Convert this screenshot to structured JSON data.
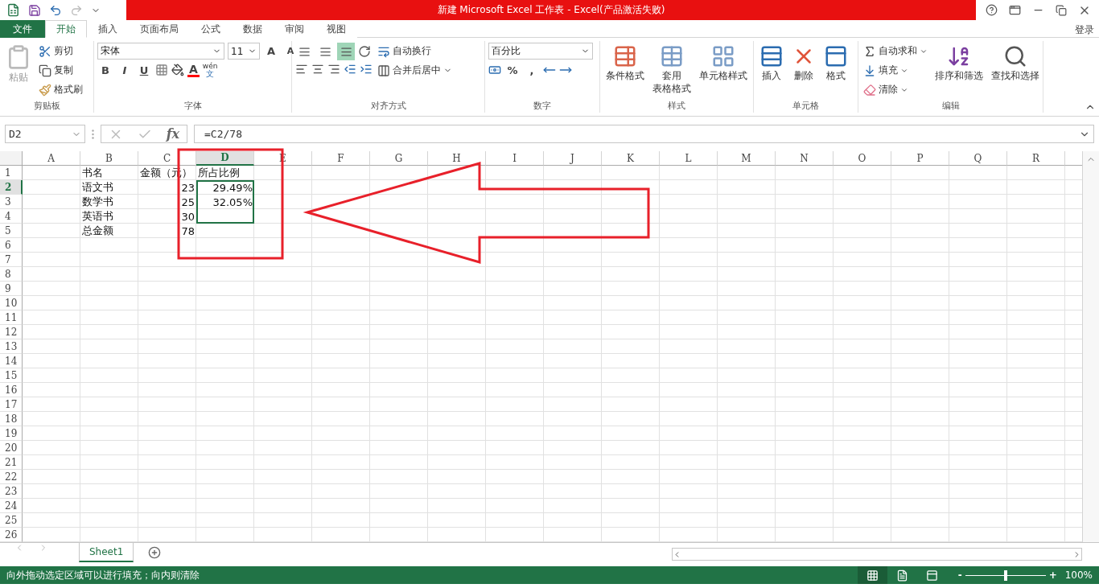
{
  "window": {
    "title": "新建 Microsoft Excel 工作表 -  Excel(产品激活失败)"
  },
  "ribbon_tabs": [
    {
      "label": "文件",
      "kind": "file",
      "selected": false
    },
    {
      "label": "开始",
      "kind": "tab",
      "selected": true
    },
    {
      "label": "插入",
      "kind": "tab",
      "selected": false
    },
    {
      "label": "页面布局",
      "kind": "tab",
      "selected": false
    },
    {
      "label": "公式",
      "kind": "tab",
      "selected": false
    },
    {
      "label": "数据",
      "kind": "tab",
      "selected": false
    },
    {
      "label": "审阅",
      "kind": "tab",
      "selected": false
    },
    {
      "label": "视图",
      "kind": "tab",
      "selected": false
    }
  ],
  "account": "登录",
  "ribbon": {
    "clipboard": {
      "label": "剪贴板",
      "paste": {
        "label": "粘贴",
        "disabled": true
      },
      "small": [
        "剪切",
        "复制",
        "格式刷"
      ]
    },
    "font": {
      "label": "字体",
      "font_name": "宋体",
      "font_size": "11",
      "grow": "A",
      "shrink": "A",
      "styles": [
        "B",
        "I",
        "U"
      ],
      "font_color": "A",
      "phonetic_top": "wén",
      "phonetic_bottom": "文"
    },
    "alignment": {
      "label": "对齐方式",
      "vertical": [
        {
          "selected": false
        },
        {
          "selected": false
        },
        {
          "selected": true
        }
      ],
      "wrap": "自动换行",
      "merge": "合并后居中"
    },
    "number": {
      "label": "数字",
      "format": "百分比",
      "percent": "%",
      "comma": ","
    },
    "styles": {
      "label": "样式",
      "buttons": [
        {
          "lines": [
            "条件格式"
          ]
        },
        {
          "lines": [
            "套用",
            "表格格式"
          ]
        },
        {
          "lines": [
            "单元格样式"
          ]
        }
      ]
    },
    "cells": {
      "label": "单元格",
      "buttons": [
        "插入",
        "删除",
        "格式"
      ]
    },
    "editing": {
      "label": "编辑",
      "small": [
        "自动求和",
        "填充",
        "清除"
      ],
      "large": [
        "排序和筛选",
        "查找和选择"
      ]
    }
  },
  "formula_bar": {
    "name_box": "D2",
    "fx": "fx",
    "formula": "=C2/78"
  },
  "columns": [
    {
      "label": "A",
      "selected": false
    },
    {
      "label": "B",
      "selected": false
    },
    {
      "label": "C",
      "selected": false
    },
    {
      "label": "D",
      "selected": true
    },
    {
      "label": "E",
      "selected": false
    },
    {
      "label": "F",
      "selected": false
    },
    {
      "label": "G",
      "selected": false
    },
    {
      "label": "H",
      "selected": false
    },
    {
      "label": "I",
      "selected": false
    },
    {
      "label": "J",
      "selected": false
    },
    {
      "label": "K",
      "selected": false
    },
    {
      "label": "L",
      "selected": false
    },
    {
      "label": "M",
      "selected": false
    },
    {
      "label": "N",
      "selected": false
    },
    {
      "label": "O",
      "selected": false
    },
    {
      "label": "P",
      "selected": false
    },
    {
      "label": "Q",
      "selected": false
    },
    {
      "label": "R",
      "selected": false
    }
  ],
  "rows": [
    {
      "number": "1",
      "selected": false,
      "cells": [
        null,
        {
          "text": "书名",
          "kind": "text",
          "selected": false
        },
        {
          "text": "金额（元）",
          "kind": "text",
          "selected": false
        },
        {
          "text": "所占比例",
          "kind": "text",
          "selected": false
        }
      ]
    },
    {
      "number": "2",
      "selected": true,
      "cells": [
        null,
        {
          "text": "语文书",
          "kind": "text",
          "selected": false
        },
        {
          "text": "23",
          "kind": "number",
          "selected": false
        },
        {
          "text": "29.49%",
          "kind": "number",
          "selected": true
        }
      ]
    },
    {
      "number": "3",
      "selected": false,
      "cells": [
        null,
        {
          "text": "数学书",
          "kind": "text",
          "selected": false
        },
        {
          "text": "25",
          "kind": "number",
          "selected": false
        },
        {
          "text": "32.05%",
          "kind": "number",
          "selected": true
        }
      ]
    },
    {
      "number": "4",
      "selected": false,
      "cells": [
        null,
        {
          "text": "英语书",
          "kind": "text",
          "selected": false
        },
        {
          "text": "30",
          "kind": "number",
          "selected": false
        },
        {
          "kind": "number",
          "selected": true
        }
      ]
    },
    {
      "number": "5",
      "selected": false,
      "cells": [
        null,
        {
          "text": "总金额",
          "kind": "text",
          "selected": false
        },
        {
          "text": "78",
          "kind": "number",
          "selected": false
        }
      ]
    },
    {
      "number": "6",
      "selected": false
    },
    {
      "number": "7",
      "selected": false
    },
    {
      "number": "8",
      "selected": false
    },
    {
      "number": "9",
      "selected": false
    },
    {
      "number": "10",
      "selected": false
    },
    {
      "number": "11",
      "selected": false
    },
    {
      "number": "12",
      "selected": false
    },
    {
      "number": "13",
      "selected": false
    },
    {
      "number": "14",
      "selected": false
    },
    {
      "number": "15",
      "selected": false
    },
    {
      "number": "16",
      "selected": false
    },
    {
      "number": "17",
      "selected": false
    },
    {
      "number": "18",
      "selected": false
    },
    {
      "number": "19",
      "selected": false
    },
    {
      "number": "20",
      "selected": false
    },
    {
      "number": "21",
      "selected": false
    },
    {
      "number": "22",
      "selected": false
    },
    {
      "number": "23",
      "selected": false
    },
    {
      "number": "24",
      "selected": false
    },
    {
      "number": "25",
      "selected": false
    },
    {
      "number": "26",
      "selected": false
    }
  ],
  "sheet_tabs": [
    {
      "label": "Sheet1",
      "selected": true
    }
  ],
  "status_bar": {
    "message": "向外拖动选定区域可以进行填充；向内则清除",
    "views": [
      {
        "selected": true
      },
      {
        "selected": false
      },
      {
        "selected": false
      }
    ],
    "zoom_minus": "-",
    "zoom_plus": "+",
    "zoom": "100%",
    "level": 0.5
  }
}
